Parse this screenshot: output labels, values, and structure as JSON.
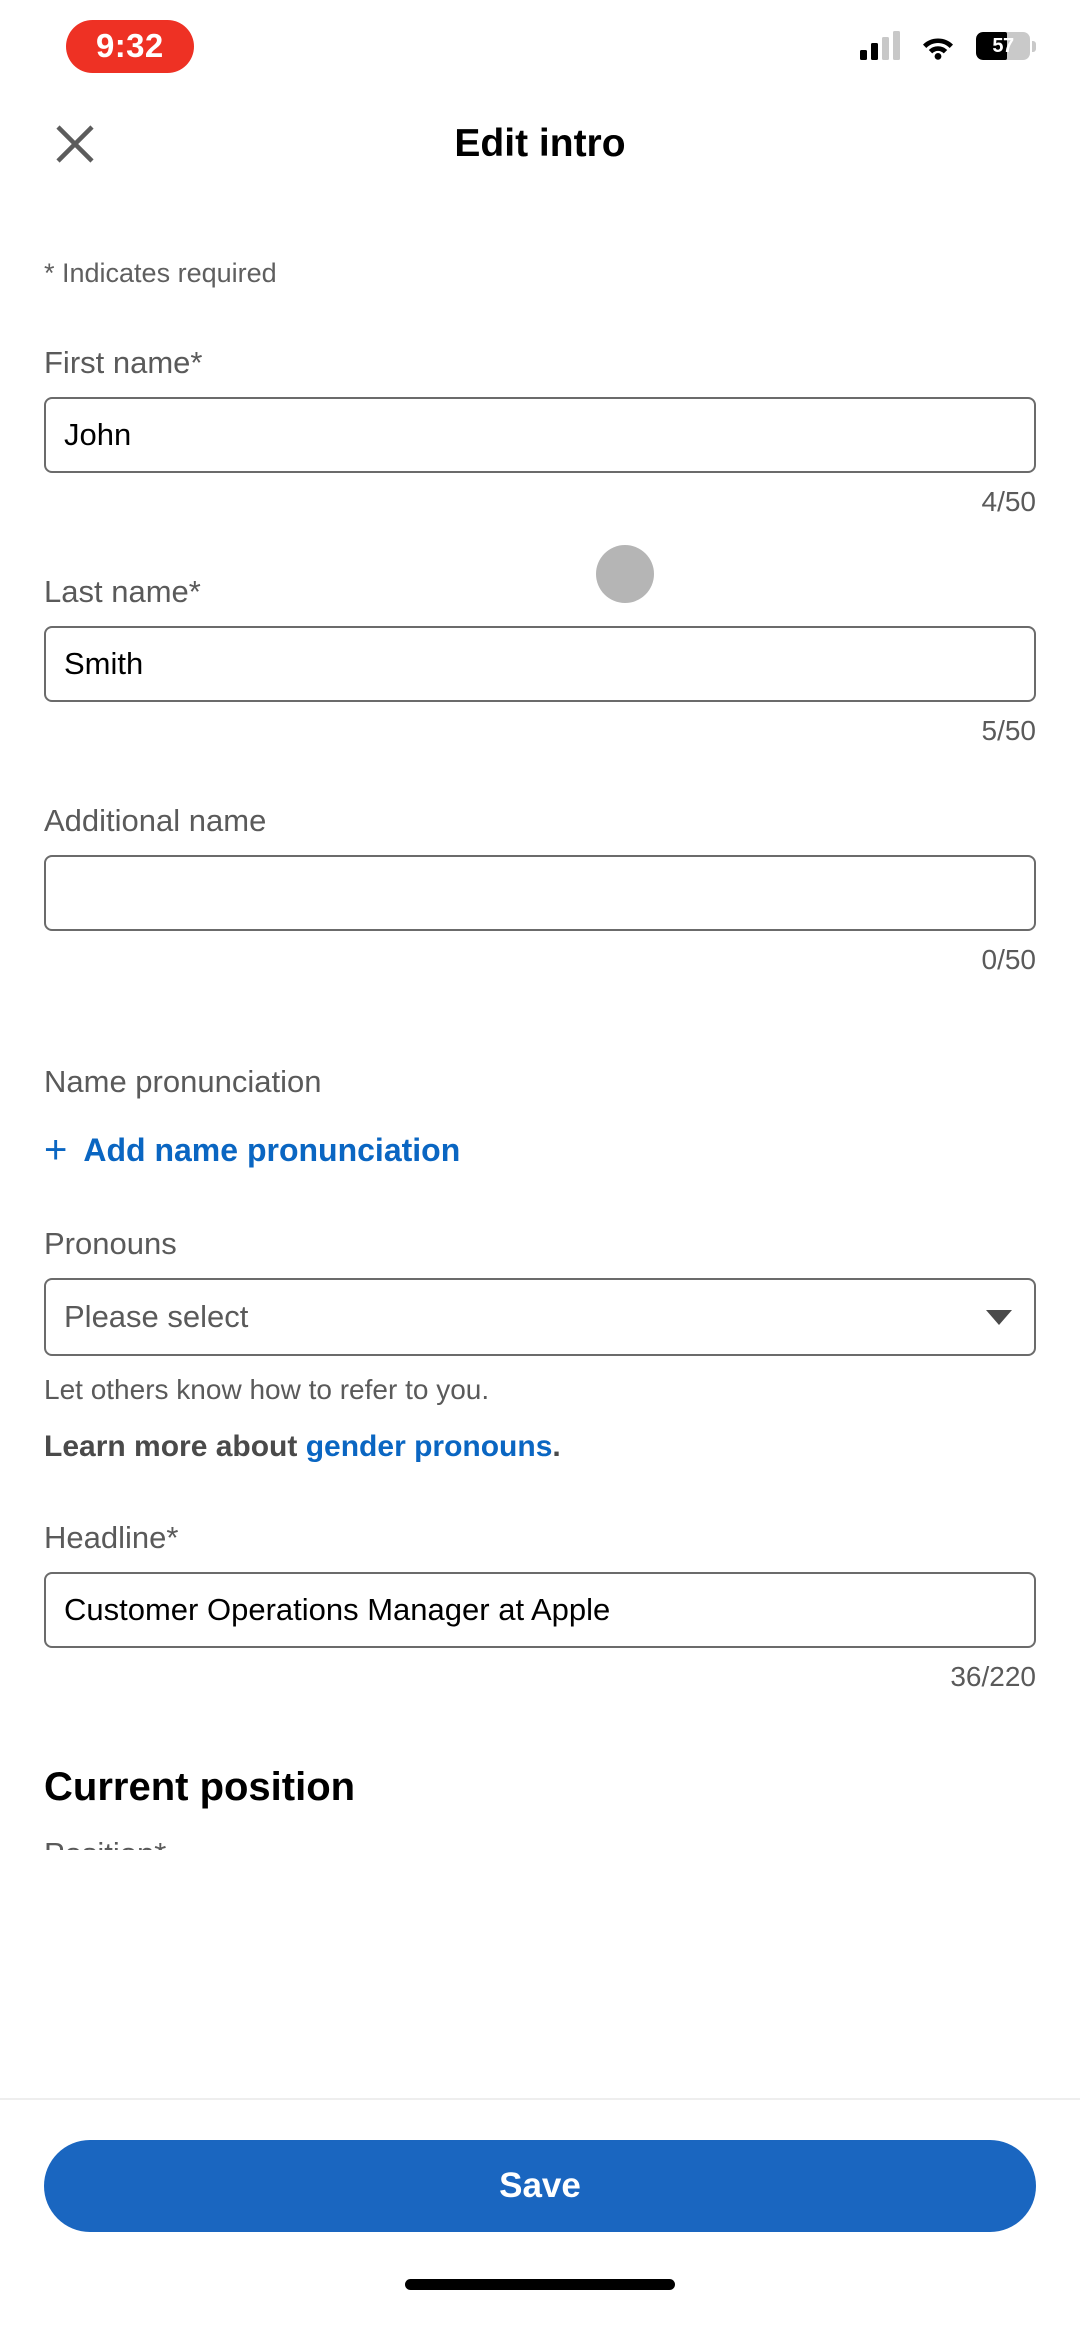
{
  "status_bar": {
    "time": "9:32",
    "recording_pill_color": "#ee3124",
    "battery_percent": "57",
    "battery_level": 57,
    "signal_icon": "cellular-signal-icon",
    "wifi_icon": "wifi-icon",
    "battery_icon": "battery-icon"
  },
  "nav": {
    "close_icon": "close-icon",
    "title": "Edit intro"
  },
  "form": {
    "required_note": "* Indicates required",
    "first_name": {
      "label": "First name*",
      "value": "John",
      "placeholder": "",
      "counter": "4/50"
    },
    "last_name": {
      "label": "Last name*",
      "value": "Smith",
      "placeholder": "",
      "counter": "5/50"
    },
    "additional_name": {
      "label": "Additional name",
      "value": "",
      "placeholder": "",
      "counter": "0/50"
    },
    "name_pronunciation": {
      "label": "Name pronunciation",
      "add_link": "Add name pronunciation",
      "plus_icon": "plus-icon"
    },
    "pronouns": {
      "label": "Pronouns",
      "selected": "Please select",
      "caret_icon": "chevron-down-icon",
      "helper": "Let others know how to refer to you.",
      "learn_more_prefix": "Learn more about ",
      "learn_more_link": "gender pronouns",
      "learn_more_suffix": "."
    },
    "headline": {
      "label": "Headline*",
      "value": "Customer Operations Manager at Apple",
      "placeholder": "",
      "counter": "36/220"
    },
    "current_position": {
      "heading": "Current position",
      "clipped_label": "Position*"
    }
  },
  "footer": {
    "save_label": "Save",
    "save_color": "#1a66c0",
    "home_indicator": "home-indicator"
  },
  "colors": {
    "link_blue": "#0a66c2",
    "primary_blue": "#1a66c0",
    "recording_red": "#ee3124",
    "label_gray": "#5a5a5a",
    "border_gray": "#6b6b6b"
  }
}
